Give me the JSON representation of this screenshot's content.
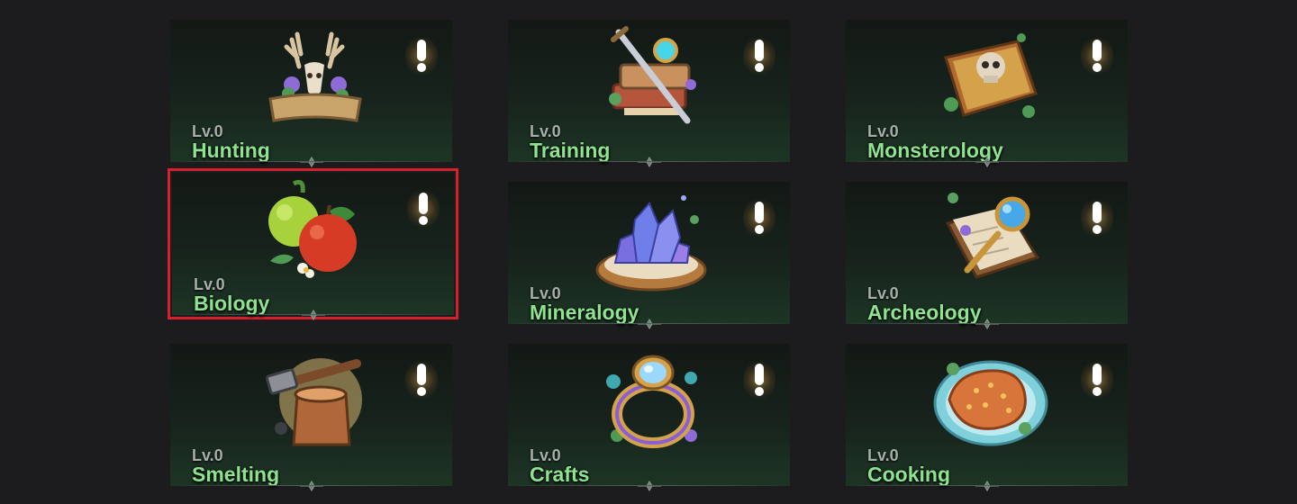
{
  "skills": [
    {
      "level": "Lv.0",
      "name": "Hunting",
      "icon": "antler-sign-icon",
      "alert": true,
      "selected": false
    },
    {
      "level": "Lv.0",
      "name": "Training",
      "icon": "sword-book-icon",
      "alert": true,
      "selected": false
    },
    {
      "level": "Lv.0",
      "name": "Monsterology",
      "icon": "skull-book-icon",
      "alert": true,
      "selected": false
    },
    {
      "level": "Lv.0",
      "name": "Biology",
      "icon": "apples-icon",
      "alert": true,
      "selected": true
    },
    {
      "level": "Lv.0",
      "name": "Mineralogy",
      "icon": "crystal-icon",
      "alert": true,
      "selected": false
    },
    {
      "level": "Lv.0",
      "name": "Archeology",
      "icon": "magnifier-book-icon",
      "alert": true,
      "selected": false
    },
    {
      "level": "Lv.0",
      "name": "Smelting",
      "icon": "hammer-anvil-icon",
      "alert": true,
      "selected": false
    },
    {
      "level": "Lv.0",
      "name": "Crafts",
      "icon": "gem-ring-icon",
      "alert": true,
      "selected": false
    },
    {
      "level": "Lv.0",
      "name": "Cooking",
      "icon": "meat-plate-icon",
      "alert": true,
      "selected": false
    }
  ],
  "colors": {
    "background": "#1c1c1e",
    "name_text": "#8de38f",
    "level_text": "#a7afaa",
    "selection_outline": "#d6212c",
    "alert_glow": "#ffbe5a"
  }
}
